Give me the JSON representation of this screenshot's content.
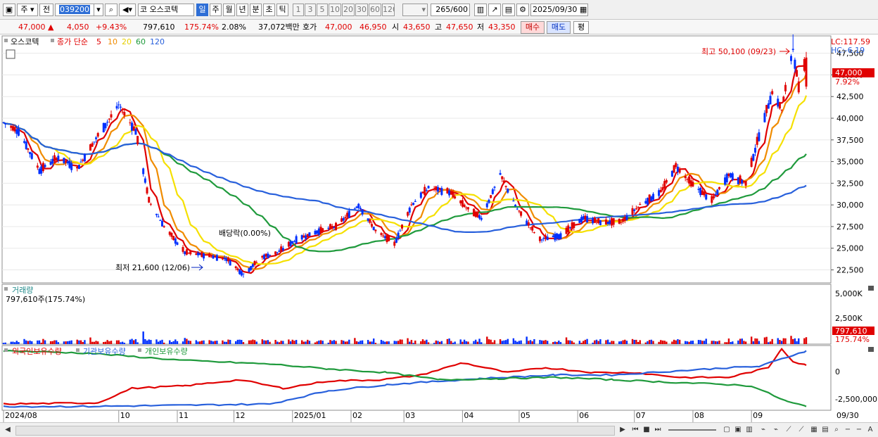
{
  "toolbar": {
    "market_btn": "주",
    "prev_btn": "전",
    "code": "039200",
    "stock_prefix": "코",
    "stock_name": "오스코텍",
    "periods": [
      "일",
      "주",
      "월",
      "년",
      "분",
      "초",
      "틱"
    ],
    "active_period": "일",
    "ticks": [
      "1",
      "3",
      "5",
      "10",
      "20",
      "30",
      "60",
      "120"
    ],
    "count": "265",
    "count_total": "/600",
    "date": "2025/09/30"
  },
  "quote": {
    "price": "47,000",
    "change": "4,050",
    "change_pct": "+9.43%",
    "volume": "797,610",
    "volume_ratio": "175.74%",
    "turnover": "2.08%",
    "amount": "37,072백만",
    "hoga_label": "호가",
    "ask": "47,000",
    "bid": "46,950",
    "open_label": "시",
    "open": "43,650",
    "high_label": "고",
    "high": "47,650",
    "low_label": "저",
    "low": "43,350",
    "buy_btn": "매수",
    "sell_btn": "매도",
    "eval_btn": "평"
  },
  "price_panel": {
    "stock_label": "오스코텍",
    "ma_label": "종가 단순",
    "ma_periods": [
      "5",
      "10",
      "20",
      "60",
      "120"
    ],
    "ma_colors": [
      "#e00000",
      "#f08c00",
      "#f5e000",
      "#1f9a3c",
      "#2860dc"
    ],
    "lc": "LC:117.59",
    "hc": "HC:-6.19",
    "high_note": "최고 50,100 (09/23)",
    "low_note": "최저 21,600 (12/06)",
    "dividend_note": "배당락(0.00%)",
    "current_price": "47,000",
    "current_pct": "7.92%"
  },
  "volume_panel": {
    "title": "거래량",
    "last_label": "797,610주(175.74%)",
    "current": "797,610",
    "current_pct": "175.74%",
    "ticks": [
      "5,000K",
      "2,500K"
    ]
  },
  "holdings_panel": {
    "legend": [
      "외국인보유수량",
      "기관보유수량",
      "개인보유수량"
    ],
    "ticks": [
      "0",
      "-2,500,000"
    ]
  },
  "xaxis_labels": [
    "2024/08",
    "10",
    "11",
    "12",
    "2025/01",
    "02",
    "03",
    "04",
    "05",
    "06",
    "07",
    "08",
    "09",
    "09/30"
  ],
  "chart_data": {
    "type": "candlestick",
    "ylim": [
      21000,
      49500
    ],
    "yticks": [
      22500,
      25000,
      27500,
      30000,
      32500,
      35000,
      37500,
      40000,
      42500,
      45000,
      47500
    ],
    "ytick_labels": [
      "22,500",
      "25,000",
      "27,500",
      "30,000",
      "32,500",
      "35,000",
      "37,500",
      "40,000",
      "42,500",
      "45,000",
      "47,500"
    ],
    "close_waypoints": [
      {
        "d": "2024-08-01",
        "c": 39500
      },
      {
        "d": "2024-08-09",
        "c": 38500
      },
      {
        "d": "2024-08-20",
        "c": 34000
      },
      {
        "d": "2024-08-30",
        "c": 35500
      },
      {
        "d": "2024-09-09",
        "c": 34200
      },
      {
        "d": "2024-09-20",
        "c": 38000
      },
      {
        "d": "2024-10-01",
        "c": 41500
      },
      {
        "d": "2024-10-10",
        "c": 38500
      },
      {
        "d": "2024-10-17",
        "c": 30500
      },
      {
        "d": "2024-10-25",
        "c": 27500
      },
      {
        "d": "2024-11-05",
        "c": 24500
      },
      {
        "d": "2024-11-15",
        "c": 24200
      },
      {
        "d": "2024-11-27",
        "c": 23800
      },
      {
        "d": "2024-12-06",
        "c": 22000
      },
      {
        "d": "2024-12-16",
        "c": 24000
      },
      {
        "d": "2024-12-24",
        "c": 24500
      },
      {
        "d": "2025-01-03",
        "c": 26000
      },
      {
        "d": "2025-01-15",
        "c": 27000
      },
      {
        "d": "2025-01-24",
        "c": 27500
      },
      {
        "d": "2025-02-05",
        "c": 30000
      },
      {
        "d": "2025-02-14",
        "c": 27000
      },
      {
        "d": "2025-02-24",
        "c": 25500
      },
      {
        "d": "2025-03-05",
        "c": 30000
      },
      {
        "d": "2025-03-14",
        "c": 32000
      },
      {
        "d": "2025-03-25",
        "c": 31500
      },
      {
        "d": "2025-04-04",
        "c": 29500
      },
      {
        "d": "2025-04-11",
        "c": 28500
      },
      {
        "d": "2025-04-21",
        "c": 33500
      },
      {
        "d": "2025-04-30",
        "c": 29500
      },
      {
        "d": "2025-05-12",
        "c": 26000
      },
      {
        "d": "2025-05-23",
        "c": 26500
      },
      {
        "d": "2025-06-04",
        "c": 28500
      },
      {
        "d": "2025-06-13",
        "c": 28000
      },
      {
        "d": "2025-06-24",
        "c": 28000
      },
      {
        "d": "2025-07-04",
        "c": 30000
      },
      {
        "d": "2025-07-15",
        "c": 31500
      },
      {
        "d": "2025-07-23",
        "c": 34500
      },
      {
        "d": "2025-07-31",
        "c": 32500
      },
      {
        "d": "2025-08-11",
        "c": 30500
      },
      {
        "d": "2025-08-20",
        "c": 33500
      },
      {
        "d": "2025-08-29",
        "c": 32500
      },
      {
        "d": "2025-09-05",
        "c": 38000
      },
      {
        "d": "2025-09-12",
        "c": 43000
      },
      {
        "d": "2025-09-17",
        "c": 41000
      },
      {
        "d": "2025-09-23",
        "c": 48000
      },
      {
        "d": "2025-09-26",
        "c": 43500
      },
      {
        "d": "2025-09-30",
        "c": 47000
      }
    ],
    "last_bar": {
      "date": "2025-09-30",
      "open": 43650,
      "high": 47650,
      "low": 43350,
      "close": 47000,
      "volume": 797610
    },
    "extremes": {
      "high": {
        "date": "2025-09-23",
        "value": 50100
      },
      "low": {
        "date": "2024-12-06",
        "value": 21600
      }
    },
    "volume_ylim": [
      0,
      6500000
    ],
    "holdings": {
      "ylim": [
        -3600000,
        1400000
      ],
      "series": [
        {
          "name": "외국인보유수량",
          "color": "#e00000",
          "points": [
            {
              "d": "2024-08-01",
              "v": -3200000
            },
            {
              "d": "2024-09-20",
              "v": -3100000
            },
            {
              "d": "2024-10-08",
              "v": -1900000
            },
            {
              "d": "2024-11-05",
              "v": -1700000
            },
            {
              "d": "2024-12-04",
              "v": -1200000
            },
            {
              "d": "2024-12-27",
              "v": -1900000
            },
            {
              "d": "2025-01-20",
              "v": -1300000
            },
            {
              "d": "2025-02-17",
              "v": -1200000
            },
            {
              "d": "2025-03-10",
              "v": -800000
            },
            {
              "d": "2025-04-01",
              "v": 200000
            },
            {
              "d": "2025-04-25",
              "v": -600000
            },
            {
              "d": "2025-05-15",
              "v": -200000
            },
            {
              "d": "2025-06-10",
              "v": -600000
            },
            {
              "d": "2025-07-01",
              "v": -600000
            },
            {
              "d": "2025-07-25",
              "v": -1000000
            },
            {
              "d": "2025-08-20",
              "v": -1000000
            },
            {
              "d": "2025-09-10",
              "v": -200000
            },
            {
              "d": "2025-09-17",
              "v": 1400000
            },
            {
              "d": "2025-09-23",
              "v": 300000
            },
            {
              "d": "2025-09-30",
              "v": 0
            }
          ]
        },
        {
          "name": "기관보유수량",
          "color": "#2860dc",
          "points": [
            {
              "d": "2024-08-01",
              "v": -3400000
            },
            {
              "d": "2024-09-15",
              "v": -3400000
            },
            {
              "d": "2024-11-05",
              "v": -3300000
            },
            {
              "d": "2024-12-20",
              "v": -3200000
            },
            {
              "d": "2025-01-20",
              "v": -2100000
            },
            {
              "d": "2025-02-20",
              "v": -1600000
            },
            {
              "d": "2025-04-10",
              "v": -1100000
            },
            {
              "d": "2025-05-20",
              "v": -800000
            },
            {
              "d": "2025-06-20",
              "v": -800000
            },
            {
              "d": "2025-07-20",
              "v": -500000
            },
            {
              "d": "2025-08-20",
              "v": -200000
            },
            {
              "d": "2025-09-05",
              "v": -100000
            },
            {
              "d": "2025-09-30",
              "v": 1200000
            }
          ]
        },
        {
          "name": "개인보유수량",
          "color": "#1f9a3c",
          "points": [
            {
              "d": "2024-08-01",
              "v": 1200000
            },
            {
              "d": "2024-09-15",
              "v": 1000000
            },
            {
              "d": "2024-11-05",
              "v": 400000
            },
            {
              "d": "2024-12-20",
              "v": 100000
            },
            {
              "d": "2025-01-20",
              "v": -300000
            },
            {
              "d": "2025-02-20",
              "v": -600000
            },
            {
              "d": "2025-03-20",
              "v": -1200000
            },
            {
              "d": "2025-04-20",
              "v": -1100000
            },
            {
              "d": "2025-05-20",
              "v": -1000000
            },
            {
              "d": "2025-06-20",
              "v": -1200000
            },
            {
              "d": "2025-07-20",
              "v": -1400000
            },
            {
              "d": "2025-08-20",
              "v": -1600000
            },
            {
              "d": "2025-09-01",
              "v": -1700000
            },
            {
              "d": "2025-09-20",
              "v": -3000000
            },
            {
              "d": "2025-09-30",
              "v": -3400000
            }
          ]
        }
      ]
    }
  }
}
